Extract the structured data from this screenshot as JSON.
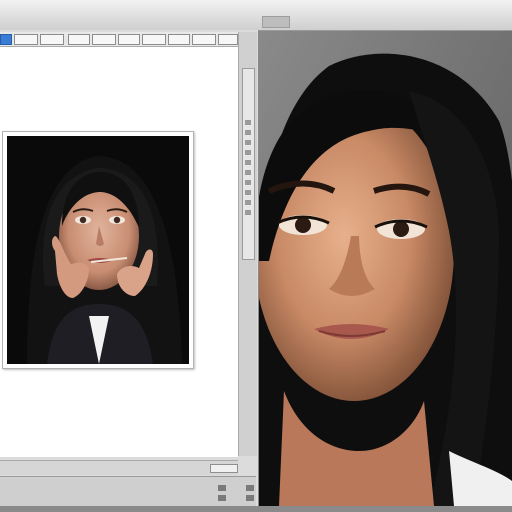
{
  "toolbar": {
    "icons": [
      "select-tool-icon",
      "view-icon",
      "page-icon",
      "image-icon",
      "layer-icon",
      "crop-icon",
      "adjust-icon",
      "grid-icon",
      "table-icon",
      "close-panel-icon"
    ],
    "active_index": 0
  },
  "colors": {
    "canvas_background": "#ffffff",
    "toolbar_active": "#3a7bd5",
    "dark_background": "#1a1a1a"
  },
  "document": {
    "photo": "portrait-photo-thumbnail"
  },
  "viewer": {
    "photo": "portrait-photo-closeup"
  }
}
